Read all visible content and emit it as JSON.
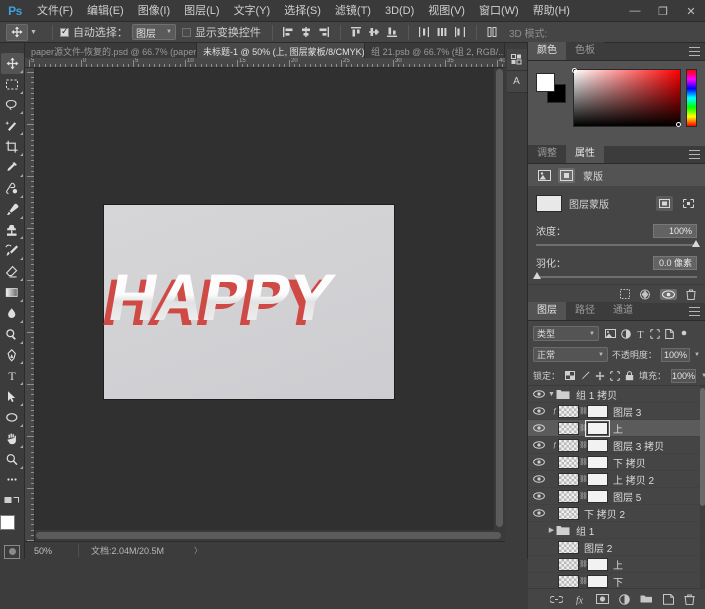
{
  "app": {
    "logo": "Ps",
    "menu": [
      "文件(F)",
      "编辑(E)",
      "图像(I)",
      "图层(L)",
      "文字(Y)",
      "选择(S)",
      "滤镜(T)",
      "3D(D)",
      "视图(V)",
      "窗口(W)",
      "帮助(H)"
    ],
    "window_controls": {
      "minimize": "—",
      "maximize": "❐",
      "close": "✕"
    }
  },
  "options_bar": {
    "tool_icon": "move-tool",
    "auto_select_checked": true,
    "auto_select_label": "自动选择：",
    "auto_select_value": "图层",
    "show_transform_checked": false,
    "show_transform_label": "显示变换控件",
    "mode_3d_label": "3D 模式:"
  },
  "tabs": [
    {
      "label": "paper源文件-恢复的.psd @ 66.7% (paper...",
      "active": false,
      "close": "✕"
    },
    {
      "label": "未标题-1 @ 50% (上, 图层蒙板/8/CMYK) *",
      "active": true,
      "close": "✕"
    },
    {
      "label": "组 21.psb @ 66.7% (组 2, RGB/...",
      "active": false,
      "close": "✕"
    }
  ],
  "toolbar": {
    "tools": [
      {
        "name": "move-tool",
        "active": true
      },
      {
        "name": "rectangular-marquee-tool",
        "active": false
      },
      {
        "name": "lasso-tool",
        "active": false
      },
      {
        "name": "quick-selection-tool",
        "active": false
      },
      {
        "name": "crop-tool",
        "active": false
      },
      {
        "name": "eyedropper-tool",
        "active": false
      },
      {
        "name": "spot-healing-brush-tool",
        "active": false
      },
      {
        "name": "brush-tool",
        "active": false
      },
      {
        "name": "clone-stamp-tool",
        "active": false
      },
      {
        "name": "history-brush-tool",
        "active": false
      },
      {
        "name": "eraser-tool",
        "active": false
      },
      {
        "name": "gradient-tool",
        "active": false
      },
      {
        "name": "blur-tool",
        "active": false
      },
      {
        "name": "dodge-tool",
        "active": false
      },
      {
        "name": "pen-tool",
        "active": false
      },
      {
        "name": "type-tool",
        "active": false
      },
      {
        "name": "path-selection-tool",
        "active": false
      },
      {
        "name": "ellipse-shape-tool",
        "active": false
      },
      {
        "name": "hand-tool",
        "active": false
      },
      {
        "name": "zoom-tool",
        "active": false
      },
      {
        "name": "edit-toolbar-tool",
        "active": false
      }
    ],
    "foreground_color": "#ffffff",
    "background_color": "#000000"
  },
  "canvas": {
    "artwork_text": "HAPPY",
    "artwork_fill": "#f2f2f2",
    "artwork_shadow_color": "#d9534f",
    "background_color": "#d3d3d6",
    "ruler_labels_h": [
      "5",
      "0",
      "5",
      "10",
      "15",
      "20",
      "25",
      "30",
      "35",
      "40",
      "45"
    ],
    "ruler_labels_v": [
      "5",
      "0",
      "5",
      "10",
      "15",
      "20",
      "25"
    ]
  },
  "status_bar": {
    "zoom": "50%",
    "doc_label": "文档:2.04M/20.5M",
    "arrow": "〉"
  },
  "dock_strip": {
    "icons": [
      "library-panel-icon",
      "character-panel-icon"
    ],
    "labels": [
      "",
      "A"
    ]
  },
  "color_panel": {
    "tabs": [
      {
        "label": "颜色",
        "active": true
      },
      {
        "label": "色板",
        "active": false
      }
    ],
    "foreground": "#ffffff",
    "background": "#000000",
    "hue": "#ff0000"
  },
  "properties_panel": {
    "tabs": [
      {
        "label": "调整",
        "active": false
      },
      {
        "label": "属性",
        "active": true
      }
    ],
    "header_title": "蒙版",
    "mask_name": "图层蒙版",
    "density_label": "浓度：",
    "density_value": "100%",
    "density_percent": 100,
    "feather_label": "羽化：",
    "feather_value": "0.0 像素",
    "feather_percent": 0
  },
  "layers_panel": {
    "tabs": [
      {
        "label": "图层",
        "active": true
      },
      {
        "label": "路径",
        "active": false
      },
      {
        "label": "通道",
        "active": false
      }
    ],
    "filter_value": "类型",
    "blend_mode": "正常",
    "opacity_label": "不透明度：",
    "opacity_value": "100%",
    "lock_label": "锁定：",
    "fill_label": "填充：",
    "fill_value": "100%",
    "layers": [
      {
        "name": "组 1 拷贝",
        "type": "group",
        "indent": 0,
        "visible": true,
        "selected": false,
        "expanded": true,
        "has_fx": false,
        "has_mask": false
      },
      {
        "name": "图层 3",
        "type": "layer",
        "indent": 1,
        "visible": true,
        "selected": false,
        "has_fx": true,
        "has_mask": true,
        "thumb": "checker"
      },
      {
        "name": "上",
        "type": "layer",
        "indent": 1,
        "visible": true,
        "selected": true,
        "has_fx": false,
        "has_mask": true,
        "thumb": "checker"
      },
      {
        "name": "图层 3 拷贝",
        "type": "layer",
        "indent": 1,
        "visible": true,
        "selected": false,
        "has_fx": true,
        "has_mask": true,
        "thumb": "checker"
      },
      {
        "name": "下 拷贝",
        "type": "layer",
        "indent": 1,
        "visible": true,
        "selected": false,
        "has_fx": false,
        "has_mask": true,
        "thumb": "checker"
      },
      {
        "name": "上 拷贝 2",
        "type": "layer",
        "indent": 1,
        "visible": true,
        "selected": false,
        "has_fx": false,
        "has_mask": true,
        "thumb": "checker"
      },
      {
        "name": "图层 5",
        "type": "layer",
        "indent": 1,
        "visible": true,
        "selected": false,
        "has_fx": false,
        "has_mask": true,
        "thumb": "checker"
      },
      {
        "name": "下 拷贝 2",
        "type": "layer",
        "indent": 1,
        "visible": true,
        "selected": false,
        "has_fx": false,
        "has_mask": false,
        "thumb": "checker"
      },
      {
        "name": "组 1",
        "type": "group",
        "indent": 0,
        "visible": false,
        "selected": false,
        "expanded": false,
        "has_fx": false,
        "has_mask": false
      },
      {
        "name": "图层 2",
        "type": "layer",
        "indent": 1,
        "visible": false,
        "selected": false,
        "has_fx": false,
        "has_mask": false,
        "thumb": "checker"
      },
      {
        "name": "上",
        "type": "layer",
        "indent": 1,
        "visible": false,
        "selected": false,
        "has_fx": false,
        "has_mask": true,
        "thumb": "checker"
      },
      {
        "name": "下",
        "type": "layer",
        "indent": 1,
        "visible": false,
        "selected": false,
        "has_fx": false,
        "has_mask": true,
        "thumb": "checker"
      }
    ],
    "footer_icons": [
      "link-layers-icon",
      "layer-style-fx-icon",
      "add-layer-mask-icon",
      "adjustment-layer-icon",
      "new-group-icon",
      "new-layer-icon",
      "delete-layer-icon"
    ]
  }
}
